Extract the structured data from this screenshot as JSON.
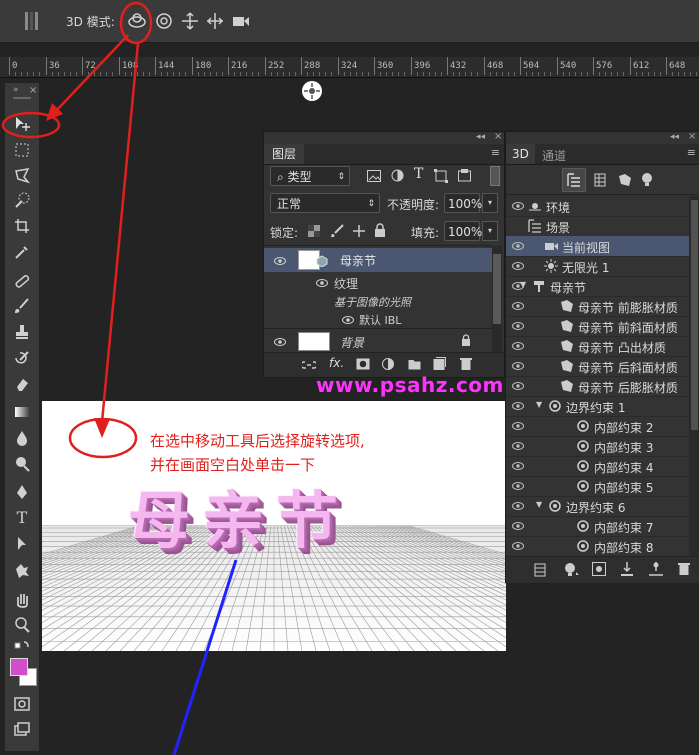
{
  "options_bar": {
    "mode_label": "3D 模式:"
  },
  "ruler": {
    "labels": [
      "0",
      "36",
      "72",
      "108",
      "144",
      "180",
      "216",
      "252",
      "288",
      "324",
      "360",
      "396",
      "432",
      "468",
      "504",
      "540",
      "576",
      "612",
      "648"
    ]
  },
  "layers_panel": {
    "tab": "图层",
    "filter_kind": "类型",
    "blend_mode": "正常",
    "opacity_label": "不透明度:",
    "opacity_value": "100%",
    "lock_label": "锁定:",
    "fill_label": "填充:",
    "fill_value": "100%",
    "layers": [
      {
        "name": "母亲节"
      },
      {
        "name": "纹理"
      },
      {
        "name": "基于图像的光照"
      },
      {
        "name": "默认 IBL"
      },
      {
        "name": "背景"
      }
    ]
  },
  "panel_3d": {
    "tabs": [
      "3D",
      "通道"
    ],
    "rows": [
      {
        "label": "环境"
      },
      {
        "label": "场景"
      },
      {
        "label": "当前视图"
      },
      {
        "label": "无限光 1"
      },
      {
        "label": "母亲节"
      },
      {
        "label": "母亲节 前膨胀材质"
      },
      {
        "label": "母亲节 前斜面材质"
      },
      {
        "label": "母亲节 凸出材质"
      },
      {
        "label": "母亲节 后斜面材质"
      },
      {
        "label": "母亲节 后膨胀材质"
      },
      {
        "label": "边界约束 1"
      },
      {
        "label": "内部约束 2"
      },
      {
        "label": "内部约束 3"
      },
      {
        "label": "内部约束 4"
      },
      {
        "label": "内部约束 5"
      },
      {
        "label": "边界约束 6"
      },
      {
        "label": "内部约束 7"
      },
      {
        "label": "内部约束 8"
      }
    ]
  },
  "annotations": {
    "watermark": "www.psahz.com",
    "note_line1": "在选中移动工具后选择旋转选项,",
    "note_line2": "并在画面空白处单击一下"
  },
  "canvas": {
    "text_3d": "母亲节"
  },
  "colors": {
    "annotation_red": "#e0201c",
    "watermark": "#ff33ff",
    "text_pink": "#f5b7ef",
    "foreground_swatch": "#d04fc8",
    "highlight_row": "#4b5670"
  }
}
